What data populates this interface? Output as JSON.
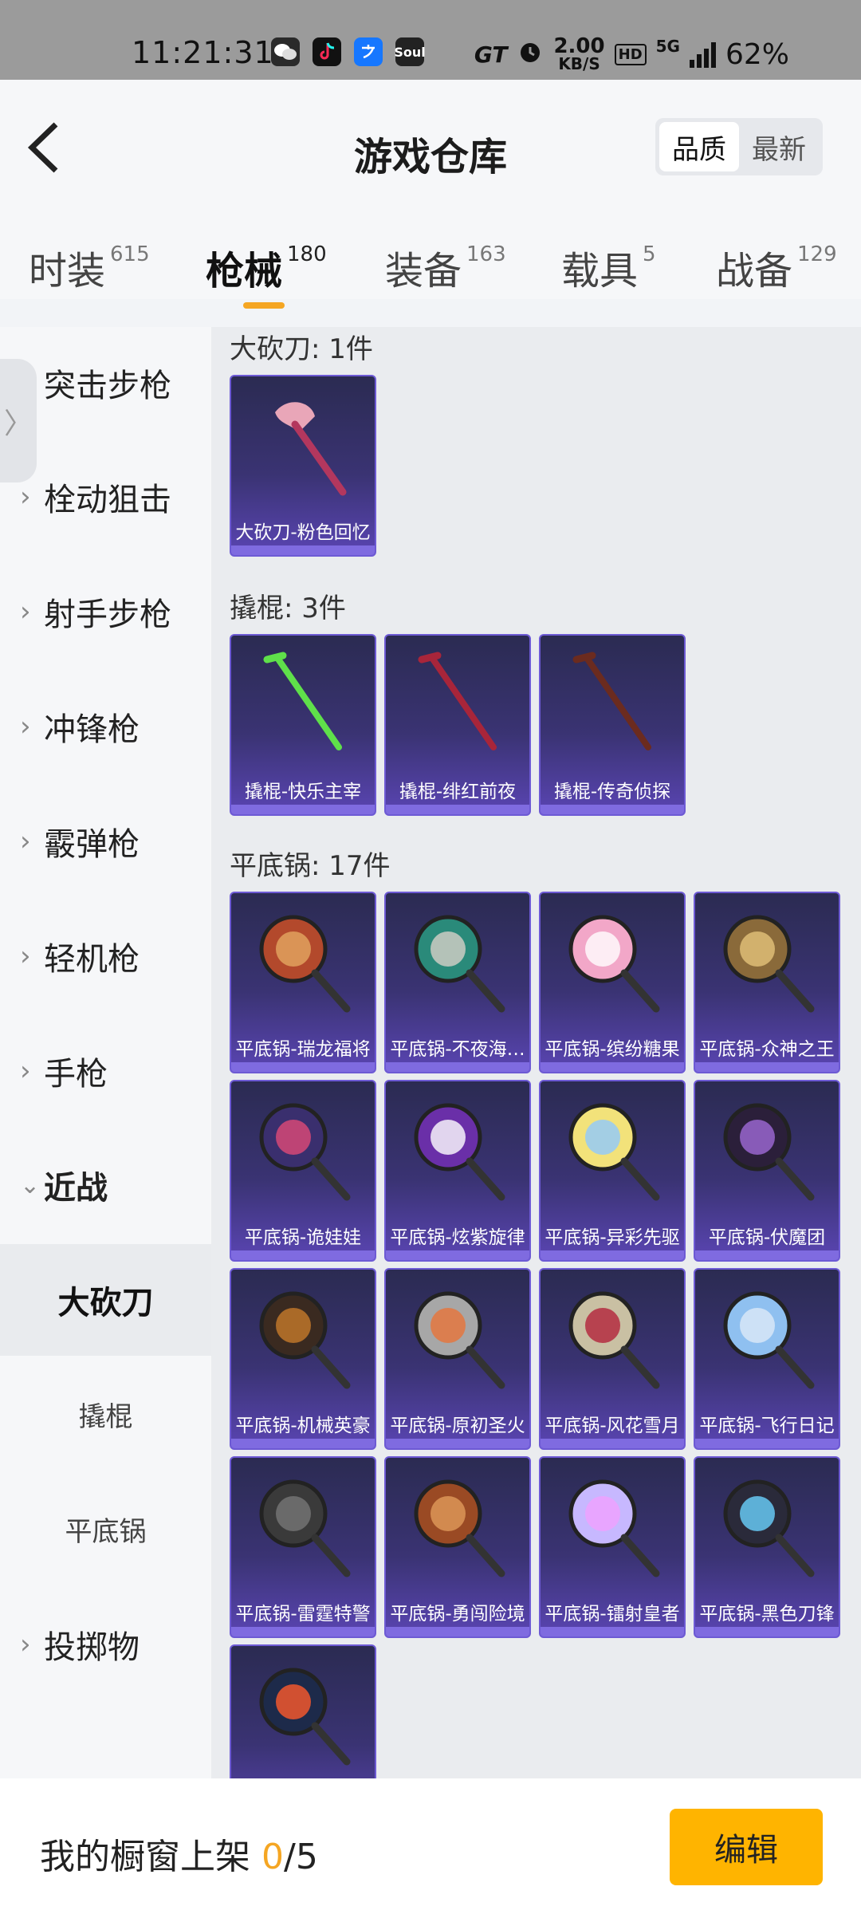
{
  "status_bar": {
    "time": "11:21:31",
    "net_speed_value": "2.00",
    "net_speed_unit": "KB/S",
    "hd": "HD",
    "network": "5G",
    "battery": "62%",
    "gt": "GT",
    "soul": "Soul"
  },
  "header": {
    "title": "游戏仓库",
    "sort_options": [
      "品质",
      "最新"
    ],
    "sort_active": "品质"
  },
  "tabs": [
    {
      "label": "时装",
      "count": "615"
    },
    {
      "label": "枪械",
      "count": "180"
    },
    {
      "label": "装备",
      "count": "163"
    },
    {
      "label": "载具",
      "count": "5"
    },
    {
      "label": "战备",
      "count": "129"
    }
  ],
  "sidebar": {
    "handle_glyph": "〉",
    "categories": [
      "突击步枪",
      "栓动狙击",
      "射手步枪",
      "冲锋枪",
      "霰弹枪",
      "轻机枪",
      "手枪",
      "近战"
    ],
    "subcategories": [
      "大砍刀",
      "撬棍",
      "平底锅"
    ],
    "last_category": "投掷物"
  },
  "sections": [
    {
      "title": "大砍刀: 1件",
      "items": [
        "大砍刀-粉色回忆"
      ]
    },
    {
      "title": "撬棍: 3件",
      "items": [
        "撬棍-快乐主宰",
        "撬棍-绯红前夜",
        "撬棍-传奇侦探"
      ]
    },
    {
      "title": "平底锅: 17件",
      "items": [
        "平底锅-瑞龙福将",
        "平底锅-不夜海…",
        "平底锅-缤纷糖果",
        "平底锅-众神之王",
        "平底锅-诡娃娃",
        "平底锅-炫紫旋律",
        "平底锅-异彩先驱",
        "平底锅-伏魔团",
        "平底锅-机械英豪",
        "平底锅-原初圣火",
        "平底锅-风花雪月",
        "平底锅-飞行日记",
        "平底锅-雷霆特警",
        "平底锅-勇闯险境",
        "平底锅-镭射皇者",
        "平底锅-黑色刀锋",
        ""
      ]
    }
  ],
  "bottom": {
    "showcase_label": "我的橱窗上架",
    "current": "0",
    "total": "/5",
    "edit_label": "编辑"
  },
  "colors": {
    "accent": "#f5a623",
    "edit_button": "#ffb400",
    "card_bg": "#3a3373"
  }
}
